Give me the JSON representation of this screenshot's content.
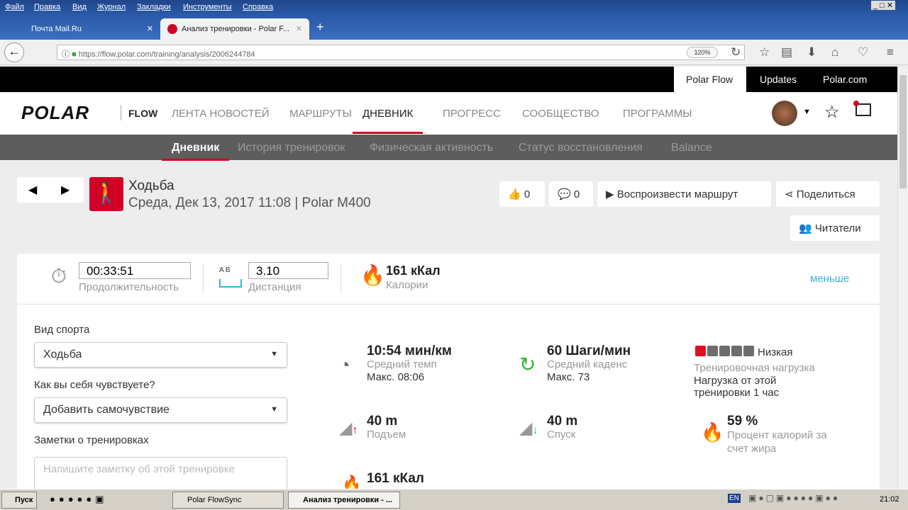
{
  "browser": {
    "menu": [
      "Файл",
      "Правка",
      "Вид",
      "Журнал",
      "Закладки",
      "Инструменты",
      "Справка"
    ],
    "tabs": [
      {
        "label": "Почта Mail.Ru"
      },
      {
        "label": "Анализ тренировки - Polar F..."
      }
    ],
    "url": "https://flow.polar.com/training/analysis/2006244784",
    "zoom": "120%"
  },
  "topbar": [
    "Polar Flow",
    "Updates",
    "Polar.com"
  ],
  "nav": {
    "logo": "POLAR",
    "flow": "FLOW",
    "items": [
      "ЛЕНТА НОВОСТЕЙ",
      "МАРШРУТЫ",
      "ДНЕВНИК",
      "ПРОГРЕСС",
      "СООБЩЕСТВО",
      "ПРОГРАММЫ"
    ]
  },
  "subnav": [
    "Дневник",
    "История тренировок",
    "Физическая активность",
    "Статус восстановления",
    "Balance"
  ],
  "session": {
    "sport": "Ходьба",
    "date": "Среда, Дек 13, 2017 11:08 | Polar M400",
    "likes": "0",
    "comments": "0",
    "replay": "Воспроизвести маршрут",
    "share": "Поделиться",
    "followers": "Читатели"
  },
  "summary": {
    "duration": "00:33:51",
    "duration_label": "Продолжительность",
    "ab": "A  B",
    "distance": "3.10",
    "distance_label": "Дистанция",
    "calories": "161 кКал",
    "calories_label": "Калории",
    "less": "меньше"
  },
  "form": {
    "sport_label": "Вид спорта",
    "sport_value": "Ходьба",
    "feel_label": "Как вы себя чувствуете?",
    "feel_value": "Добавить самочувствие",
    "notes_label": "Заметки о тренировках",
    "notes_placeholder": "Напишите заметку об этой тренировке"
  },
  "stats": {
    "pace": "10:54 мин/км",
    "pace_label": "Средний темп",
    "pace_max": "Макс. 08:06",
    "cadence": "60 Шаги/мин",
    "cadence_label": "Средний каденс",
    "cadence_max": "Макс. 73",
    "load_level": "Низкая",
    "load_value": 1,
    "load_max": 5,
    "load_label": "Тренировочная нагрузка",
    "load_desc": "Нагрузка от этой тренировки 1 час",
    "ascent": "40 m",
    "ascent_label": "Подъем",
    "descent": "40 m",
    "descent_label": "Спуск",
    "fat": "59 %",
    "fat_label": "Процент калорий за счет жира",
    "kcal": "161 кКал"
  },
  "taskbar": {
    "start": "Пуск",
    "tasks": [
      "Polar FlowSync",
      "Анализ тренировки - ..."
    ],
    "lang": "EN",
    "time": "21:02"
  }
}
